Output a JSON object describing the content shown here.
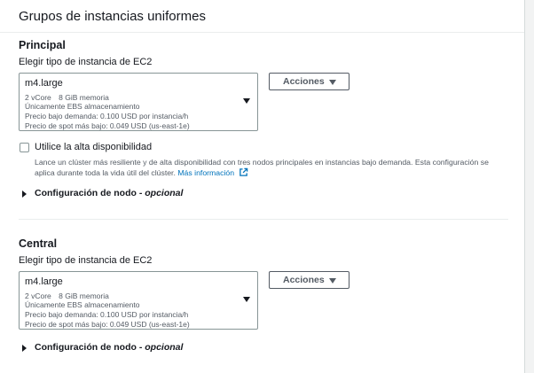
{
  "page": {
    "title": "Grupos de instancias uniformes"
  },
  "groups": [
    {
      "title": "Principal",
      "instance_label": "Elegir tipo de instancia de EC2",
      "instance": {
        "name": "m4.large",
        "vcore": "2 vCore",
        "memory": "8 GiB memoria",
        "storage": "Únicamente EBS almacenamiento",
        "on_demand_price": "Precio bajo demanda: 0.100 USD por instancia/h",
        "spot_price": "Precio de spot más bajo: 0.049 USD (us-east-1e)"
      },
      "actions_label": "Acciones",
      "high_availability": {
        "label": "Utilice la alta disponibilidad",
        "checked": false,
        "description_line1": "Lance un clúster más resiliente y de alta disponibilidad con tres nodos principales en instancias bajo demanda. Esta configuración se",
        "description_line2": "aplica durante toda la vida útil del clúster.",
        "learn_more": "Más información"
      },
      "node_config": {
        "label": "Configuración de nodo",
        "separator": " - ",
        "optional": "opcional"
      }
    },
    {
      "title": "Central",
      "instance_label": "Elegir tipo de instancia de EC2",
      "instance": {
        "name": "m4.large",
        "vcore": "2 vCore",
        "memory": "8 GiB memoria",
        "storage": "Únicamente EBS almacenamiento",
        "on_demand_price": "Precio bajo demanda: 0.100 USD por instancia/h",
        "spot_price": "Precio de spot más bajo: 0.049 USD (us-east-1e)"
      },
      "actions_label": "Acciones",
      "node_config": {
        "label": "Configuración de nodo",
        "separator": " - ",
        "optional": "opcional"
      }
    }
  ],
  "colors": {
    "link": "#0073bb",
    "text": "#16191f",
    "secondary_text": "#545b64",
    "border": "#879596"
  },
  "icons": {
    "external_link": "external-link-icon",
    "dropdown": "caret-down-icon",
    "expander": "caret-right-icon"
  }
}
